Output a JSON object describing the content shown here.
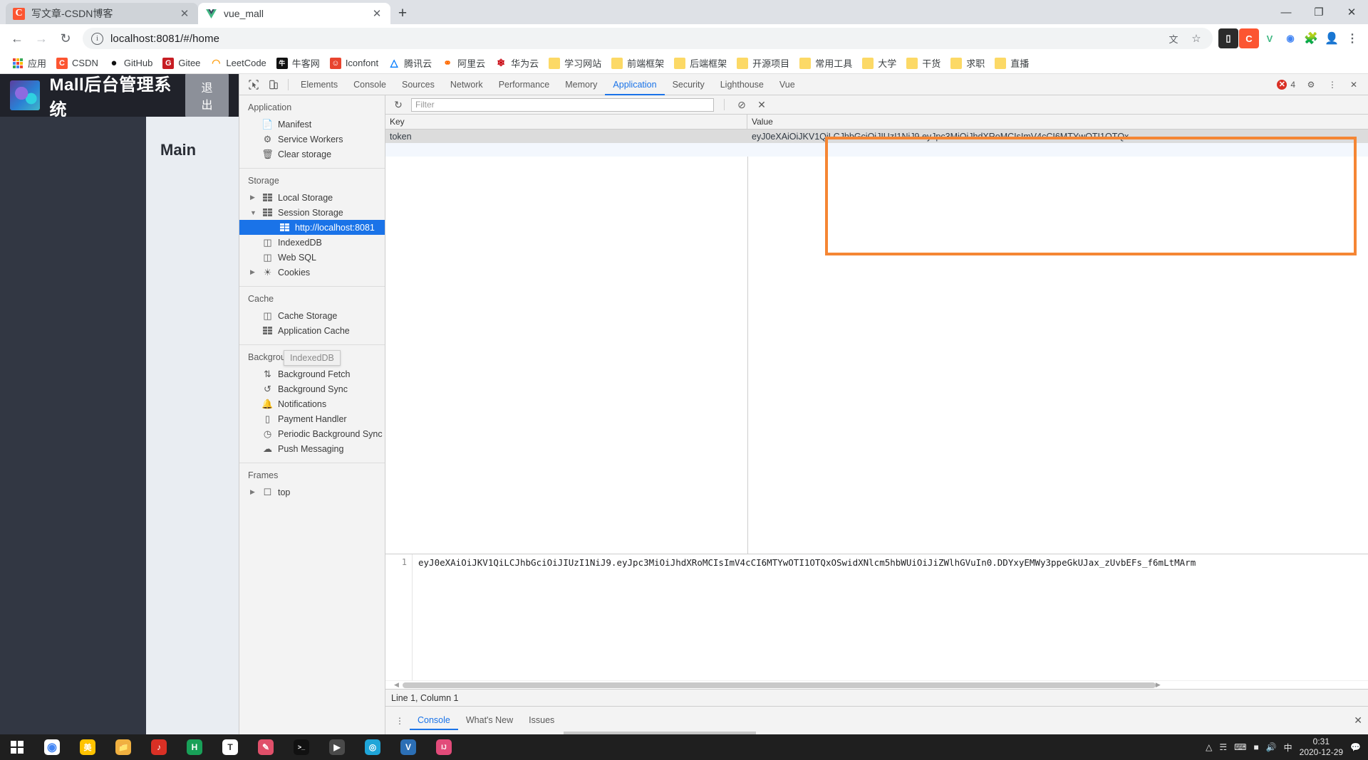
{
  "browser": {
    "tabs": [
      {
        "title": "写文章-CSDN博客",
        "favicon": "csdn-icon",
        "active": false
      },
      {
        "title": "vue_mall",
        "favicon": "vue-icon",
        "active": true
      }
    ],
    "new_tab_label": "+",
    "window_controls": {
      "minimize": "—",
      "maximize": "❐",
      "close": "✕"
    },
    "nav": {
      "back": "←",
      "forward": "→",
      "reload": "↻"
    },
    "omnibox": {
      "info_icon": "i",
      "url": "localhost:8081/#/home",
      "value": "localhost:8081/#/home"
    },
    "toolbar_icons": [
      "translate-icon",
      "star-icon",
      "extension-blue-icon",
      "csdn-ext-icon",
      "vue-ext-icon",
      "chrome-ext-icon",
      "puzzle-icon",
      "profile-icon",
      "menu-icon"
    ],
    "bookmarks": [
      {
        "label": "应用",
        "icon": "apps-grid-icon"
      },
      {
        "label": "CSDN",
        "icon": "csdn-icon"
      },
      {
        "label": "GitHub",
        "icon": "github-icon"
      },
      {
        "label": "Gitee",
        "icon": "gitee-icon"
      },
      {
        "label": "LeetCode",
        "icon": "leetcode-icon"
      },
      {
        "label": "牛客网",
        "icon": "nowcoder-icon"
      },
      {
        "label": "Iconfont",
        "icon": "iconfont-icon"
      },
      {
        "label": "腾讯云",
        "icon": "tencent-cloud-icon"
      },
      {
        "label": "阿里云",
        "icon": "aliyun-icon"
      },
      {
        "label": "华为云",
        "icon": "huawei-cloud-icon"
      },
      {
        "label": "学习网站",
        "icon": "folder-icon"
      },
      {
        "label": "前端框架",
        "icon": "folder-icon"
      },
      {
        "label": "后端框架",
        "icon": "folder-icon"
      },
      {
        "label": "开源项目",
        "icon": "folder-icon"
      },
      {
        "label": "常用工具",
        "icon": "folder-icon"
      },
      {
        "label": "大学",
        "icon": "folder-icon"
      },
      {
        "label": "干货",
        "icon": "folder-icon"
      },
      {
        "label": "求职",
        "icon": "folder-icon"
      },
      {
        "label": "直播",
        "icon": "folder-icon"
      }
    ]
  },
  "webapp": {
    "title": "Mall后台管理系统",
    "logout_label": "退出",
    "main_label": "Main"
  },
  "devtools": {
    "inspect_icon": "cursor-inspect-icon",
    "device_icon": "device-toggle-icon",
    "tabs": [
      {
        "label": "Elements",
        "active": false
      },
      {
        "label": "Console",
        "active": false
      },
      {
        "label": "Sources",
        "active": false
      },
      {
        "label": "Network",
        "active": false
      },
      {
        "label": "Performance",
        "active": false
      },
      {
        "label": "Memory",
        "active": false
      },
      {
        "label": "Application",
        "active": true
      },
      {
        "label": "Security",
        "active": false
      },
      {
        "label": "Lighthouse",
        "active": false
      },
      {
        "label": "Vue",
        "active": false
      }
    ],
    "error_count": "4",
    "settings_icon": "gear-icon",
    "more_icon": "kebab-menu-icon",
    "close_icon": "close-icon",
    "sidebar": [
      {
        "title": "Application",
        "items": [
          {
            "label": "Manifest",
            "icon": "document-icon",
            "twisty": "",
            "selected": false,
            "nested": false
          },
          {
            "label": "Service Workers",
            "icon": "gear-icon",
            "twisty": "",
            "selected": false,
            "nested": false
          },
          {
            "label": "Clear storage",
            "icon": "trash-icon",
            "twisty": "",
            "selected": false,
            "nested": false
          }
        ]
      },
      {
        "title": "Storage",
        "items": [
          {
            "label": "Local Storage",
            "icon": "table-grid-icon",
            "twisty": "▶",
            "selected": false,
            "nested": false
          },
          {
            "label": "Session Storage",
            "icon": "table-grid-icon",
            "twisty": "▼",
            "selected": false,
            "nested": false
          },
          {
            "label": "http://localhost:8081",
            "icon": "table-grid-icon",
            "twisty": "",
            "selected": true,
            "nested": true
          },
          {
            "label": "IndexedDB",
            "icon": "database-icon",
            "twisty": "",
            "selected": false,
            "nested": false
          },
          {
            "label": "Web SQL",
            "icon": "database-icon",
            "twisty": "",
            "selected": false,
            "nested": false
          },
          {
            "label": "Cookies",
            "icon": "cookie-icon",
            "twisty": "▶",
            "selected": false,
            "nested": false
          }
        ]
      },
      {
        "title": "Cache",
        "items": [
          {
            "label": "Cache Storage",
            "icon": "database-icon",
            "twisty": "",
            "selected": false,
            "nested": false
          },
          {
            "label": "Application Cache",
            "icon": "table-grid-icon",
            "twisty": "",
            "selected": false,
            "nested": false
          }
        ]
      },
      {
        "title": "Background Services",
        "items": [
          {
            "label": "Background Fetch",
            "icon": "updown-arrow-icon",
            "twisty": "",
            "selected": false,
            "nested": false
          },
          {
            "label": "Background Sync",
            "icon": "sync-icon",
            "twisty": "",
            "selected": false,
            "nested": false
          },
          {
            "label": "Notifications",
            "icon": "bell-icon",
            "twisty": "",
            "selected": false,
            "nested": false
          },
          {
            "label": "Payment Handler",
            "icon": "card-icon",
            "twisty": "",
            "selected": false,
            "nested": false
          },
          {
            "label": "Periodic Background Sync",
            "icon": "clock-icon",
            "twisty": "",
            "selected": false,
            "nested": false
          },
          {
            "label": "Push Messaging",
            "icon": "cloud-icon",
            "twisty": "",
            "selected": false,
            "nested": false
          }
        ]
      },
      {
        "title": "Frames",
        "items": [
          {
            "label": "top",
            "icon": "frame-icon",
            "twisty": "▶",
            "selected": false,
            "nested": false
          }
        ]
      }
    ],
    "tooltip": "IndexedDB",
    "storage_toolbar": {
      "refresh_icon": "refresh-icon",
      "filter_placeholder": "Filter",
      "filter_value": "",
      "clear_icon": "no-entry-icon",
      "delete_icon": "delete-x-icon"
    },
    "table": {
      "columns": [
        "Key",
        "Value"
      ],
      "rows": [
        {
          "key": "token",
          "value": "eyJ0eXAiOiJKV1QiLCJhbGciOiJIUzI1NiJ9.eyJpc3MiOiJhdXRoMCIsImV4cCI6MTYwOTI1OTQx…",
          "selected": true
        }
      ]
    },
    "preview": {
      "line_number": "1",
      "content": "eyJ0eXAiOiJKV1QiLCJhbGciOiJIUzI1NiJ9.eyJpc3MiOiJhdXRoMCIsImV4cCI6MTYwOTI1OTQxOSwidXNlcm5hbWUiOiJiZWlhGVuIn0.DDYxyEMWy3ppeGkUJax_zUvbEFs_f6mLtMArm"
    },
    "status": "Line 1, Column 1",
    "drawer": {
      "more_icon": "kebab-menu-icon",
      "tabs": [
        {
          "label": "Console",
          "active": true
        },
        {
          "label": "What's New",
          "active": false
        },
        {
          "label": "Issues",
          "active": false
        }
      ],
      "close_icon": "close-icon"
    },
    "highlight_color": "#f58634"
  },
  "taskbar": {
    "start_icon": "windows-start-icon",
    "apps": [
      {
        "name": "chrome-icon",
        "color": "#3b8ed0",
        "glyph": "●"
      },
      {
        "name": "meituan-icon",
        "color": "#ffc300",
        "glyph": "美"
      },
      {
        "name": "explorer-icon",
        "color": "#f0b040",
        "glyph": "▬"
      },
      {
        "name": "netease-music-icon",
        "color": "#d93025",
        "glyph": "♪"
      },
      {
        "name": "huawei-icon",
        "color": "#18a058",
        "glyph": "H"
      },
      {
        "name": "typora-icon",
        "color": "#3a3a3a",
        "glyph": "T"
      },
      {
        "name": "eraser-icon",
        "color": "#e0506a",
        "glyph": "✒"
      },
      {
        "name": "terminal-icon",
        "color": "#222222",
        "glyph": ">_"
      },
      {
        "name": "media-player-icon",
        "color": "#4a4a4a",
        "glyph": "▶"
      },
      {
        "name": "edge-icon",
        "color": "#1fa5d8",
        "glyph": "◔"
      },
      {
        "name": "vscode-icon",
        "color": "#2c6fb5",
        "glyph": "V"
      },
      {
        "name": "idea-icon",
        "color": "#e24b7a",
        "glyph": "IJ"
      }
    ],
    "tray_icons": [
      "chevron-up-icon",
      "wifi-icon",
      "keyboard-icon",
      "battery-icon",
      "volume-icon",
      "ime-icon"
    ],
    "clock_time": "0:31",
    "clock_date": "2020-12-29",
    "notification_icon": "notification-icon"
  }
}
